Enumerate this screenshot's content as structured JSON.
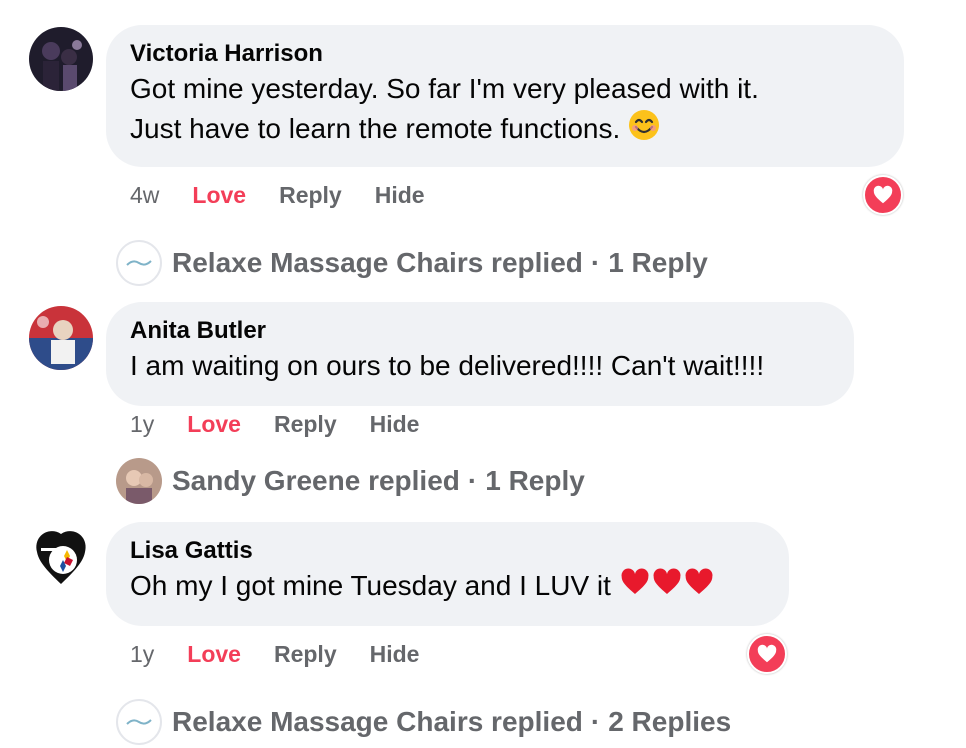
{
  "comments": [
    {
      "author": "Victoria Harrison",
      "text": "Got mine yesterday. So far I'm very pleased with it.",
      "text2": "Just have to learn the remote functions.",
      "time": "4w",
      "love": "Love",
      "reply": "Reply",
      "hide": "Hide",
      "replies": {
        "who": "Relaxe Massage Chairs replied",
        "sep": "·",
        "count": "1 Reply"
      }
    },
    {
      "author": "Anita Butler",
      "text": "I am waiting on ours to be delivered!!!! Can't wait!!!!",
      "time": "1y",
      "love": "Love",
      "reply": "Reply",
      "hide": "Hide",
      "replies": {
        "who": "Sandy Greene replied",
        "sep": "·",
        "count": "1 Reply"
      }
    },
    {
      "author": "Lisa Gattis",
      "text": "Oh my I got mine Tuesday and I LUV it",
      "time": "1y",
      "love": "Love",
      "reply": "Reply",
      "hide": "Hide",
      "replies": {
        "who": "Relaxe Massage Chairs replied",
        "sep": "·",
        "count": "2 Replies"
      }
    }
  ],
  "colors": {
    "love": "#f33e58",
    "muted": "#65676b",
    "bubble": "#f0f2f5"
  },
  "icons": [
    "smiling-face-emoji",
    "red-heart-emoji",
    "love-reaction-icon",
    "steelers-logo-avatar"
  ]
}
